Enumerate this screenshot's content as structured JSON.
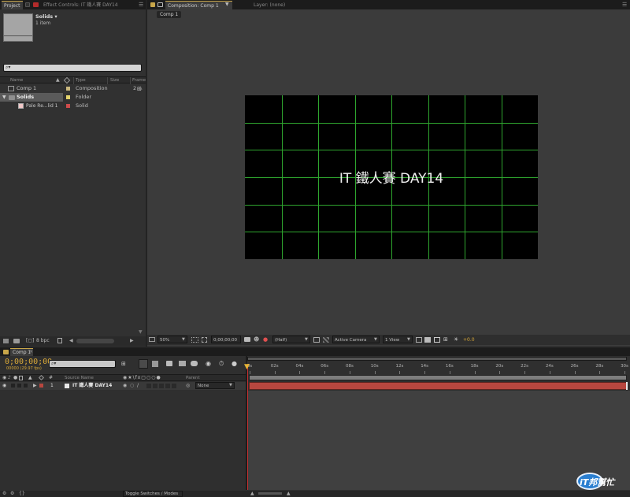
{
  "project_panel": {
    "tabs": [
      {
        "label": "Project"
      },
      {
        "label": "Effect Controls: IT 鐵人賽 DAY14"
      }
    ],
    "thumbnail_name": "Solids ▾",
    "thumbnail_info": "1 item",
    "search_placeholder": "⌕▾",
    "columns": [
      "Name",
      "Type",
      "Size",
      "Frame"
    ],
    "items": [
      {
        "name": "Comp 1",
        "type": "Composition",
        "size": "2",
        "color": "#c9b77e"
      },
      {
        "name": "Solids",
        "type": "Folder",
        "size": "",
        "color": "#e3d36c"
      },
      {
        "name": "Pale Re...lid 1",
        "type": "Solid",
        "size": "",
        "color": "#cd4b4b"
      }
    ],
    "bpc": "8 bpc"
  },
  "comp_panel": {
    "tabs": [
      {
        "label": "Composition: Comp 1"
      },
      {
        "label": "Layer: (none)"
      }
    ],
    "sub_tab": "Comp 1",
    "canvas_text": "IT 鐵人賽 DAY14",
    "grid_color": "#2ea52e",
    "toolbar": {
      "zoom": "50%",
      "timecode": "0;00;00;00",
      "resolution": "(Half)",
      "camera": "Active Camera",
      "views": "1 View",
      "exposure": "+0.0"
    }
  },
  "timeline_panel": {
    "tab": "Comp 1",
    "timecode": "0;00;00;00",
    "frame_info": "00000 (29.97 fps)",
    "search_placeholder": "⌕▾",
    "ruler": [
      "0s",
      "02s",
      "04s",
      "06s",
      "08s",
      "10s",
      "12s",
      "14s",
      "16s",
      "18s",
      "20s",
      "22s",
      "24s",
      "26s",
      "28s",
      "30s"
    ],
    "columns": {
      "source_name": "Source Name",
      "parent": "Parent"
    },
    "layers": [
      {
        "num": "1",
        "name": "IT 鐵人賽 DAY14",
        "parent": "None",
        "label_color": "#b8473f"
      }
    ],
    "toggle_label": "Toggle Switches / Modes",
    "layer_bar_color": "#b8473f",
    "work_area_color": "#7d7d7d"
  },
  "watermark": {
    "text": "iT邦幫忙"
  }
}
